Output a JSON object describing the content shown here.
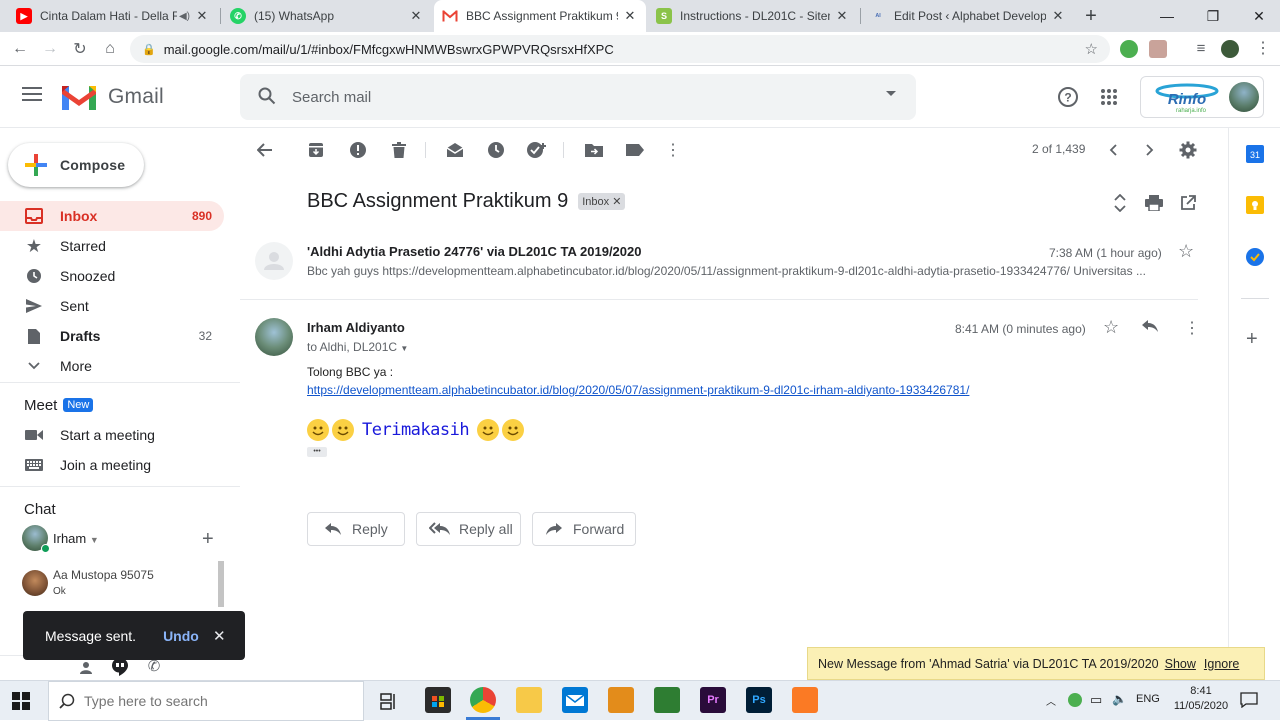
{
  "browser": {
    "tabs": [
      {
        "title": "Cinta Dalam Hati - Della Fi",
        "favicon": "youtube-icon",
        "color": "#ff0000",
        "active": false
      },
      {
        "title": "(15) WhatsApp",
        "favicon": "whatsapp-icon",
        "color": "#25d366",
        "active": false
      },
      {
        "title": "BBC Assignment Praktikum 9 -",
        "favicon": "gmail-icon",
        "color": "#ea4335",
        "active": true
      },
      {
        "title": "Instructions - DL201C - Sitem E",
        "favicon": "sitem-icon",
        "color": "#8bc34a",
        "active": false
      },
      {
        "title": "Edit Post ‹ Alphabet Developm",
        "favicon": "alphabet-icon",
        "color": "#4a6fb5",
        "active": false
      }
    ],
    "new_tab": "+",
    "url": "mail.google.com/mail/u/1/#inbox/FMfcgxwHNMWBswrxGPWPVRQsrsxHfXPC"
  },
  "gmail": {
    "logo_text": "Gmail",
    "search_placeholder": "Search mail",
    "account_logo_text": "Rinfo",
    "account_logo_sub": "raharja.info",
    "compose_label": "Compose",
    "nav": [
      {
        "label": "Inbox",
        "count": "890",
        "icon": "inbox-icon",
        "selected": true
      },
      {
        "label": "Starred",
        "count": "",
        "icon": "star-icon"
      },
      {
        "label": "Snoozed",
        "count": "",
        "icon": "clock-icon"
      },
      {
        "label": "Sent",
        "count": "",
        "icon": "send-icon"
      },
      {
        "label": "Drafts",
        "count": "32",
        "icon": "draft-icon",
        "bold": true
      },
      {
        "label": "More",
        "count": "",
        "icon": "chevron-down-icon"
      }
    ],
    "meet": {
      "title": "Meet",
      "badge": "New",
      "items": [
        {
          "label": "Start a meeting",
          "icon": "video-icon"
        },
        {
          "label": "Join a meeting",
          "icon": "keyboard-icon"
        }
      ]
    },
    "chat": {
      "title": "Chat",
      "me": "Irham",
      "contacts": [
        {
          "name": "Aa Mustopa 95075",
          "status": "Ok"
        }
      ]
    },
    "toolbar": {
      "pager": "2 of 1,439"
    },
    "thread": {
      "subject": "BBC Assignment Praktikum 9",
      "label_chip": "Inbox",
      "messages": [
        {
          "sender": "'Aldhi Adytia Prasetio 24776' via DL201C TA 2019/2020",
          "time": "7:38 AM (1 hour ago)",
          "snippet": "Bbc yah guys https://developmentteam.alphabetincubator.id/blog/2020/05/11/assignment-praktikum-9-dl201c-aldhi-adytia-prasetio-1933424776/ Universitas ..."
        },
        {
          "sender": "Irham Aldiyanto",
          "time": "8:41 AM (0 minutes ago)",
          "to": "to Aldhi, DL201C",
          "body_line1": "Tolong BBC ya :",
          "link": "https://developmentteam.alphabetincubator.id/blog/2020/05/07/assignment-praktikum-9-dl201c-irham-aldiyanto-1933426781/",
          "thanks": "Terimakasih",
          "ellipsis": "•••"
        }
      ],
      "actions": {
        "reply": "Reply",
        "reply_all": "Reply all",
        "forward": "Forward"
      }
    },
    "snackbar": {
      "text": "Message sent.",
      "undo": "Undo"
    },
    "notification": {
      "text": "New Message from 'Ahmad Satria' via DL201C TA 2019/2020",
      "show": "Show",
      "ignore": "Ignore"
    }
  },
  "taskbar": {
    "search_placeholder": "Type here to search",
    "lang": "ENG",
    "time": "8:41",
    "date": "11/05/2020"
  }
}
